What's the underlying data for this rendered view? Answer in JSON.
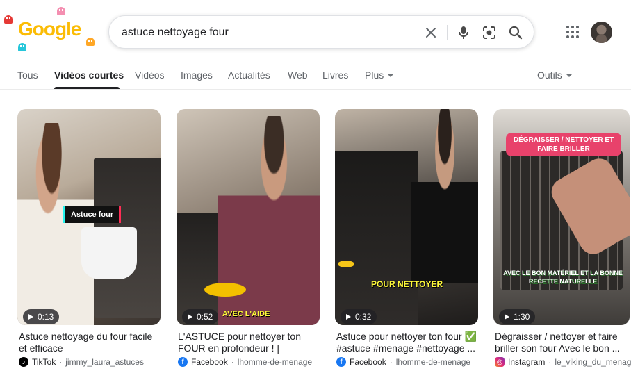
{
  "logo": {
    "letters": [
      "G",
      "o",
      "o",
      "g",
      "l",
      "e"
    ]
  },
  "search": {
    "query": "astuce nettoyage four",
    "clear_icon": "close-icon",
    "voice_icon": "mic-icon",
    "lens_icon": "camera-lens-icon",
    "search_icon": "search-icon"
  },
  "header": {
    "apps_icon": "apps-grid-icon"
  },
  "tabs": [
    {
      "label": "Tous"
    },
    {
      "label": "Vidéos courtes"
    },
    {
      "label": "Vidéos"
    },
    {
      "label": "Images"
    },
    {
      "label": "Actualités"
    },
    {
      "label": "Web"
    },
    {
      "label": "Livres"
    },
    {
      "label": "Plus"
    }
  ],
  "tools": {
    "label": "Outils"
  },
  "videos": [
    {
      "title": "Astuce nettoyage du four facile et efficace",
      "duration": "0:13",
      "platform": "TikTok",
      "channel": "jimmy_laura_astuces",
      "overlay": "Astuce four",
      "platform_color": "#000000"
    },
    {
      "title": "L'ASTUCE pour nettoyer ton FOUR en profondeur ! | lhomme...",
      "duration": "0:52",
      "platform": "Facebook",
      "channel": "lhomme-de-menage",
      "overlay": "AVEC L'AIDE",
      "platform_color": "#1877f2"
    },
    {
      "title": "Astuce pour nettoyer ton four ✅ #astuce #menage #nettoyage ...",
      "duration": "0:32",
      "platform": "Facebook",
      "channel": "lhomme-de-menage",
      "overlay": "POUR NETTOYER",
      "platform_color": "#1877f2"
    },
    {
      "title": "Dégraisser / nettoyer et faire briller son four Avec le bon ...",
      "duration": "1:30",
      "platform": "Instagram",
      "channel": "le_viking_du_menage",
      "overlay": "DÉGRAISSER / NETTOYER ET FAIRE BRILLER",
      "overlay2": "AVEC LE BON MATÉRIEL ET LA BONNE RECETTE NATURELLE",
      "platform_color": "#d6249f"
    }
  ],
  "separator": "·"
}
